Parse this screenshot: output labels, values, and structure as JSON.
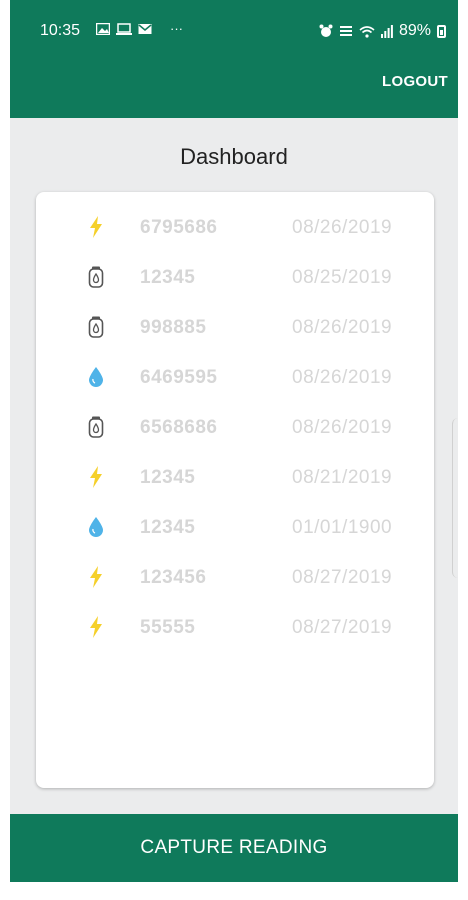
{
  "status_bar": {
    "time": "10:35",
    "more": "···",
    "battery": "89%",
    "left_icons": [
      "image-icon",
      "laptop-icon",
      "mail-icon"
    ],
    "right_icons": [
      "alarm-icon",
      "signal-text-icon",
      "wifi-icon",
      "cell-signal-icon",
      "battery-icon"
    ]
  },
  "header": {
    "logout_label": "LOGOUT",
    "color": "#0f7a5b"
  },
  "page": {
    "title": "Dashboard",
    "background": "#ebeced"
  },
  "readings": [
    {
      "type": "electric",
      "icon": "lightning-icon",
      "value": "6795686",
      "date": "08/26/2019"
    },
    {
      "type": "gas",
      "icon": "gas-meter-icon",
      "value": "12345",
      "date": "08/25/2019"
    },
    {
      "type": "gas",
      "icon": "gas-meter-icon",
      "value": "998885",
      "date": "08/26/2019"
    },
    {
      "type": "water",
      "icon": "water-drop-icon",
      "value": "6469595",
      "date": "08/26/2019"
    },
    {
      "type": "gas",
      "icon": "gas-meter-icon",
      "value": "6568686",
      "date": "08/26/2019"
    },
    {
      "type": "electric",
      "icon": "lightning-icon",
      "value": "12345",
      "date": "08/21/2019"
    },
    {
      "type": "water",
      "icon": "water-drop-icon",
      "value": "12345",
      "date": "01/01/1900"
    },
    {
      "type": "electric",
      "icon": "lightning-icon",
      "value": "123456",
      "date": "08/27/2019"
    },
    {
      "type": "electric",
      "icon": "lightning-icon",
      "value": "55555",
      "date": "08/27/2019"
    }
  ],
  "colors": {
    "lightning": "#f5d02a",
    "water": "#4fb3e8",
    "gas": "#555555",
    "row_text": "#d6d6d6"
  },
  "footer": {
    "capture_label": "CAPTURE READING"
  }
}
